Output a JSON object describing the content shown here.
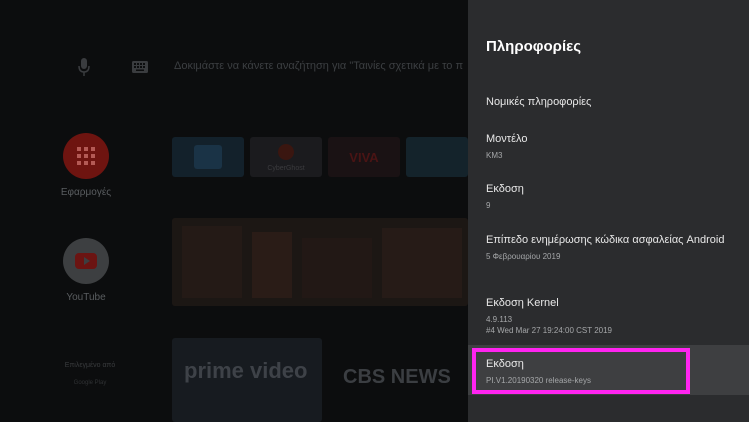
{
  "search": {
    "hint": "Δοκιμάστε να κάνετε αναζήτηση για \"Ταινίες σχετικά με το π"
  },
  "home": {
    "apps_label": "Εφαρμογές",
    "youtube_label": "YouTube",
    "promo_label": "Επιλεγμένο από",
    "promo_sub": "Google Play",
    "tiles": [
      "CyberGhost",
      "VIVA"
    ],
    "prime_label": "prime video",
    "cbs_label": "CBS NEWS"
  },
  "panel": {
    "title": "Πληροφορίες",
    "items": [
      {
        "title": "Νομικές πληροφορίες",
        "sub": "",
        "sub2": ""
      },
      {
        "title": "Μοντέλο",
        "sub": "KM3",
        "sub2": ""
      },
      {
        "title": "Εκδοση",
        "sub": "9",
        "sub2": ""
      },
      {
        "title": "Επίπεδο ενημέρωσης κώδικα ασφαλείας Android",
        "sub": "5 Φεβρουαρίου 2019",
        "sub2": ""
      },
      {
        "title": "Εκδοση Kernel",
        "sub": "4.9.113",
        "sub2": "#4 Wed Mar 27 19:24:00 CST 2019"
      },
      {
        "title": "Εκδοση",
        "sub": "PI.V1.20190320 release-keys",
        "sub2": ""
      }
    ],
    "selected_index": 5
  },
  "colors": {
    "panel_bg": "#2b2c2e",
    "highlight": "#ff24f0",
    "apps_red": "#7a1512"
  }
}
